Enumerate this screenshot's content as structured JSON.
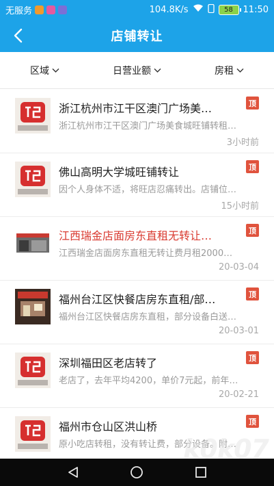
{
  "status_bar": {
    "carrier": "无服务",
    "speed": "104.8K/s",
    "battery": "58",
    "time": "11:50",
    "colors": {
      "badge1": "#f09a2d",
      "badge2": "#e35aa0",
      "badge3": "#7b6fd6",
      "battery": "#8bd24a"
    }
  },
  "header": {
    "title": "店铺转让",
    "back_icon": "chevron-left-icon",
    "background": "#1da3e8"
  },
  "filters": [
    {
      "label": "区域",
      "icon": "chevron-down-icon"
    },
    {
      "label": "日营业额",
      "icon": "chevron-down-icon"
    },
    {
      "label": "房租",
      "icon": "chevron-down-icon"
    }
  ],
  "listings": [
    {
      "title": "浙江杭州市江干区澳门广场美…",
      "desc": "浙江杭州市江干区澳门广场美食城旺铺转租…",
      "time": "3小时前",
      "badge": "顶",
      "thumb": "placeholder-logo",
      "title_color": "#1e1e1e"
    },
    {
      "title": "佛山高明大学城旺铺转让",
      "desc": "因个人身体不适，将旺店忍痛转出。店铺位…",
      "time": "15小时前",
      "badge": "顶",
      "thumb": "placeholder-logo",
      "title_color": "#1e1e1e"
    },
    {
      "title": "江西瑞金店面房东直租无转让…",
      "desc": "江西瑞金店面房东直租无转让费月租2000…",
      "time": "20-03-04",
      "badge": "顶",
      "thumb": "storefront-photo",
      "title_color": "#d93a30"
    },
    {
      "title": "福州台江区快餐店房东直租/部…",
      "desc": "福州台江区快餐店房东直租，部分设备白送…",
      "time": "20-03-01",
      "badge": "顶",
      "thumb": "restaurant-photo",
      "title_color": "#1e1e1e"
    },
    {
      "title": "深圳福田区老店转了",
      "desc": "老店了，去年平均4200，单价7元起，前年…",
      "time": "20-02-21",
      "badge": "顶",
      "thumb": "placeholder-logo",
      "title_color": "#1e1e1e"
    },
    {
      "title": "福州市仓山区洪山桥",
      "desc": "原小吃店转租，没有转让费，部分设备。附…",
      "time": "",
      "badge": "顶",
      "thumb": "placeholder-logo",
      "title_color": "#1e1e1e"
    }
  ],
  "nav_bar": {
    "back": "nav-back-icon",
    "home": "nav-home-icon",
    "recent": "nav-recent-icon"
  },
  "watermark": "k0k07"
}
